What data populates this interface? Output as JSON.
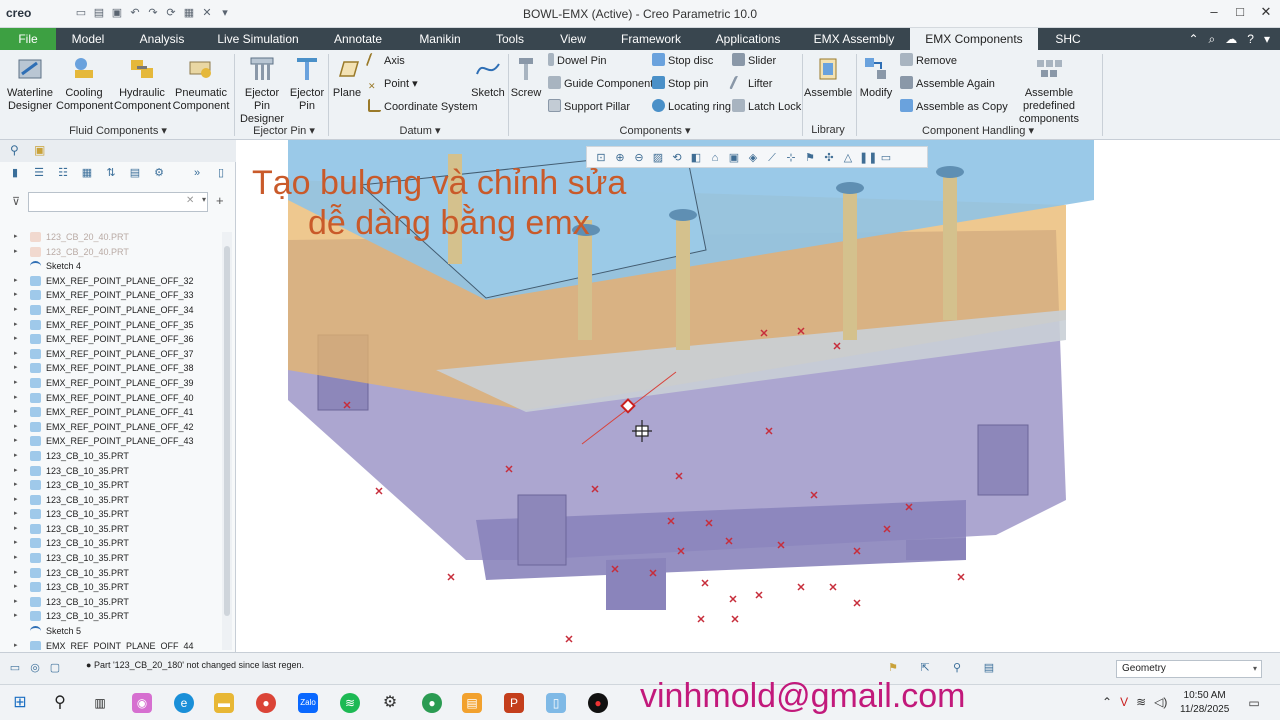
{
  "titlebar": {
    "logo": "creo",
    "title": "BOWL-EMX (Active) - Creo Parametric 10.0"
  },
  "tabs": [
    {
      "label": "File"
    },
    {
      "label": "Model"
    },
    {
      "label": "Analysis"
    },
    {
      "label": "Live Simulation"
    },
    {
      "label": "Annotate"
    },
    {
      "label": "Manikin"
    },
    {
      "label": "Tools"
    },
    {
      "label": "View"
    },
    {
      "label": "Framework"
    },
    {
      "label": "Applications"
    },
    {
      "label": "EMX Assembly"
    },
    {
      "label": "EMX Components"
    },
    {
      "label": "SHC"
    }
  ],
  "ribbon": {
    "waterline": [
      "Waterline",
      "Designer"
    ],
    "cooling": [
      "Cooling",
      "Component"
    ],
    "hydraulic": [
      "Hydraulic",
      "Component"
    ],
    "pneumatic": [
      "Pneumatic",
      "Component"
    ],
    "group_fluid": "Fluid Components",
    "ejpin_designer": [
      "Ejector Pin",
      "Designer"
    ],
    "ejpin": [
      "Ejector",
      "Pin"
    ],
    "group_ejector": "Ejector Pin",
    "plane": "Plane",
    "axis": "Axis",
    "point": "Point",
    "coordsys": "Coordinate System",
    "sketch": "Sketch",
    "group_datum": "Datum",
    "screw": "Screw",
    "dowel_pin": "Dowel Pin",
    "guide_component": "Guide Component",
    "support_pillar": "Support Pillar",
    "stop_disc": "Stop disc",
    "stop_pin": "Stop pin",
    "locating_ring": "Locating ring",
    "slider": "Slider",
    "lifter": "Lifter",
    "latch_lock": "Latch Lock",
    "group_components": "Components",
    "assemble": "Assemble",
    "group_library": "Library",
    "modify": "Modify",
    "remove": "Remove",
    "assemble_again": "Assemble Again",
    "assemble_copy": "Assemble as Copy",
    "assemble_predefined": [
      "Assemble predefined",
      "components"
    ],
    "group_handling": "Component Handling"
  },
  "tree": [
    {
      "label": "123_CB_20_40.PRT",
      "dim": true,
      "icon": "part"
    },
    {
      "label": "123_CB_20_40.PRT",
      "dim": true,
      "icon": "part"
    },
    {
      "label": "Sketch 4",
      "icon": "sketch"
    },
    {
      "label": "EMX_REF_POINT_PLANE_OFF_32",
      "icon": "part"
    },
    {
      "label": "EMX_REF_POINT_PLANE_OFF_33",
      "icon": "part"
    },
    {
      "label": "EMX_REF_POINT_PLANE_OFF_34",
      "icon": "part"
    },
    {
      "label": "EMX_REF_POINT_PLANE_OFF_35",
      "icon": "part"
    },
    {
      "label": "EMX_REF_POINT_PLANE_OFF_36",
      "icon": "part"
    },
    {
      "label": "EMX_REF_POINT_PLANE_OFF_37",
      "icon": "part"
    },
    {
      "label": "EMX_REF_POINT_PLANE_OFF_38",
      "icon": "part"
    },
    {
      "label": "EMX_REF_POINT_PLANE_OFF_39",
      "icon": "part"
    },
    {
      "label": "EMX_REF_POINT_PLANE_OFF_40",
      "icon": "part"
    },
    {
      "label": "EMX_REF_POINT_PLANE_OFF_41",
      "icon": "part"
    },
    {
      "label": "EMX_REF_POINT_PLANE_OFF_42",
      "icon": "part"
    },
    {
      "label": "EMX_REF_POINT_PLANE_OFF_43",
      "icon": "part"
    },
    {
      "label": "123_CB_10_35.PRT",
      "icon": "part"
    },
    {
      "label": "123_CB_10_35.PRT",
      "icon": "part"
    },
    {
      "label": "123_CB_10_35.PRT",
      "icon": "part"
    },
    {
      "label": "123_CB_10_35.PRT",
      "icon": "part"
    },
    {
      "label": "123_CB_10_35.PRT",
      "icon": "part"
    },
    {
      "label": "123_CB_10_35.PRT",
      "icon": "part"
    },
    {
      "label": "123_CB_10_35.PRT",
      "icon": "part"
    },
    {
      "label": "123_CB_10_35.PRT",
      "icon": "part"
    },
    {
      "label": "123_CB_10_35.PRT",
      "icon": "part"
    },
    {
      "label": "123_CB_10_35.PRT",
      "icon": "part"
    },
    {
      "label": "123_CB_10_35.PRT",
      "icon": "part"
    },
    {
      "label": "123_CB_10_35.PRT",
      "icon": "part"
    },
    {
      "label": "Sketch 5",
      "icon": "sketch"
    },
    {
      "label": "EMX_REF_POINT_PLANE_OFF_44",
      "icon": "part"
    }
  ],
  "overlay": {
    "line1": "Tạo bulong và chỉnh sửa",
    "line2": "dễ dàng bằng emx"
  },
  "status": {
    "message": "Part '123_CB_20_180' not changed since last regen.",
    "filter_value": "Geometry"
  },
  "taskbar": {
    "email": "vinhmold@gmail.com",
    "time": "10:50 AM",
    "date": "11/28/2025"
  },
  "colors": {
    "file_tab": "#3da042",
    "ribbon_bg": "#eef2f5",
    "overlay_text": "#c95a2a",
    "email_text": "#c2197b"
  }
}
